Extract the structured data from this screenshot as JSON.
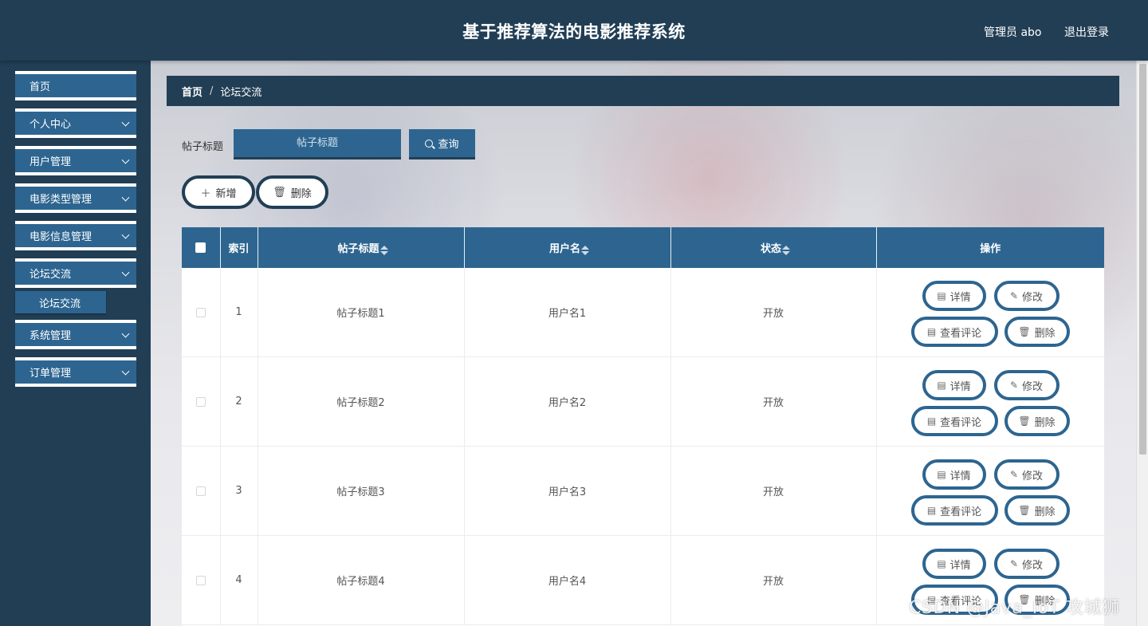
{
  "header": {
    "title": "基于推荐算法的电影推荐系统",
    "admin_label": "管理员 abo",
    "logout_label": "退出登录"
  },
  "sidebar": {
    "items": [
      {
        "label": "首页",
        "has_arrow": false
      },
      {
        "label": "个人中心",
        "has_arrow": true
      },
      {
        "label": "用户管理",
        "has_arrow": true
      },
      {
        "label": "电影类型管理",
        "has_arrow": true
      },
      {
        "label": "电影信息管理",
        "has_arrow": true
      },
      {
        "label": "论坛交流",
        "has_arrow": true
      },
      {
        "label": "系统管理",
        "has_arrow": true
      },
      {
        "label": "订单管理",
        "has_arrow": true
      }
    ],
    "submenu": {
      "label": "论坛交流"
    }
  },
  "breadcrumb": {
    "home": "首页",
    "separator": "/",
    "current": "论坛交流"
  },
  "search": {
    "label": "帖子标题",
    "placeholder": "帖子标题",
    "button_label": "查询"
  },
  "actions": {
    "add_label": "新增",
    "delete_label": "删除"
  },
  "table": {
    "columns": [
      "索引",
      "帖子标题",
      "用户名",
      "状态",
      "操作"
    ],
    "rows": [
      {
        "index": "1",
        "title": "帖子标题1",
        "username": "用户名1",
        "status": "开放"
      },
      {
        "index": "2",
        "title": "帖子标题2",
        "username": "用户名2",
        "status": "开放"
      },
      {
        "index": "3",
        "title": "帖子标题3",
        "username": "用户名3",
        "status": "开放"
      },
      {
        "index": "4",
        "title": "帖子标题4",
        "username": "用户名4",
        "status": "开放"
      }
    ],
    "row_actions": {
      "detail": "详情",
      "edit": "修改",
      "comments": "查看评论",
      "delete": "删除"
    }
  },
  "watermark": "CSDN @Java_IoT 攻城狮",
  "colors": {
    "header_bg": "#213e54",
    "accent": "#2d6590"
  }
}
